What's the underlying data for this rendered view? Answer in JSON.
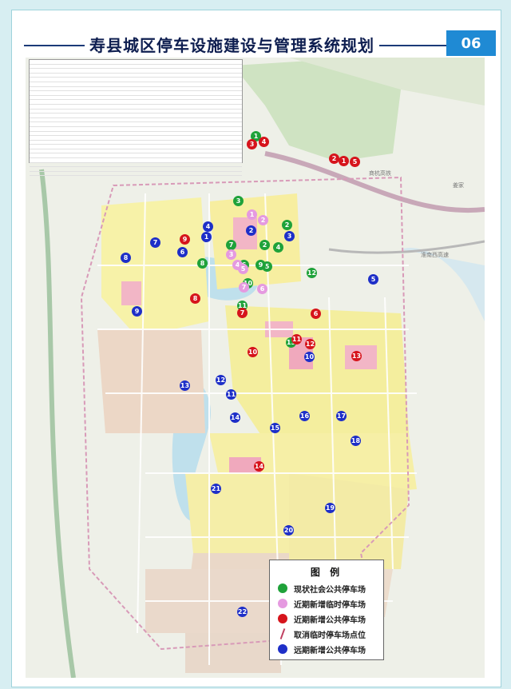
{
  "header": {
    "title": "寿县城区停车设施建设与管理系统规划",
    "page_number": "06"
  },
  "legend": {
    "title": "图  例",
    "items": [
      {
        "label": "现状社会公共停车场",
        "color": "#1fa23a",
        "shape": "circle"
      },
      {
        "label": "近期新增临时停车场",
        "color": "#e59ae0",
        "shape": "circle"
      },
      {
        "label": "近期新增公共停车场",
        "color": "#d6141c",
        "shape": "circle"
      },
      {
        "label": "取消临时停车场点位",
        "color": "#c04060",
        "shape": "slash"
      },
      {
        "label": "远期新增公共停车场",
        "color": "#1e2fc8",
        "shape": "circle"
      }
    ]
  },
  "road_labels": [
    {
      "text": "商杭高铁"
    },
    {
      "text": "淮南西高速"
    },
    {
      "text": "姜家"
    }
  ],
  "markers": {
    "green": [
      "1",
      "2",
      "3",
      "2",
      "4",
      "5",
      "6",
      "7",
      "8",
      "9",
      "10",
      "11",
      "12",
      "13"
    ],
    "pink": [
      "1",
      "2",
      "3",
      "4",
      "5",
      "6",
      "7"
    ],
    "red": [
      "1",
      "2",
      "3",
      "4",
      "5",
      "6",
      "7",
      "8",
      "9",
      "10",
      "11",
      "12",
      "13",
      "14"
    ],
    "blue": [
      "1",
      "2",
      "3",
      "4",
      "5",
      "6",
      "7",
      "8",
      "9",
      "10",
      "11",
      "12",
      "13",
      "14",
      "15",
      "16",
      "17",
      "18",
      "19",
      "20",
      "21",
      "22"
    ]
  }
}
